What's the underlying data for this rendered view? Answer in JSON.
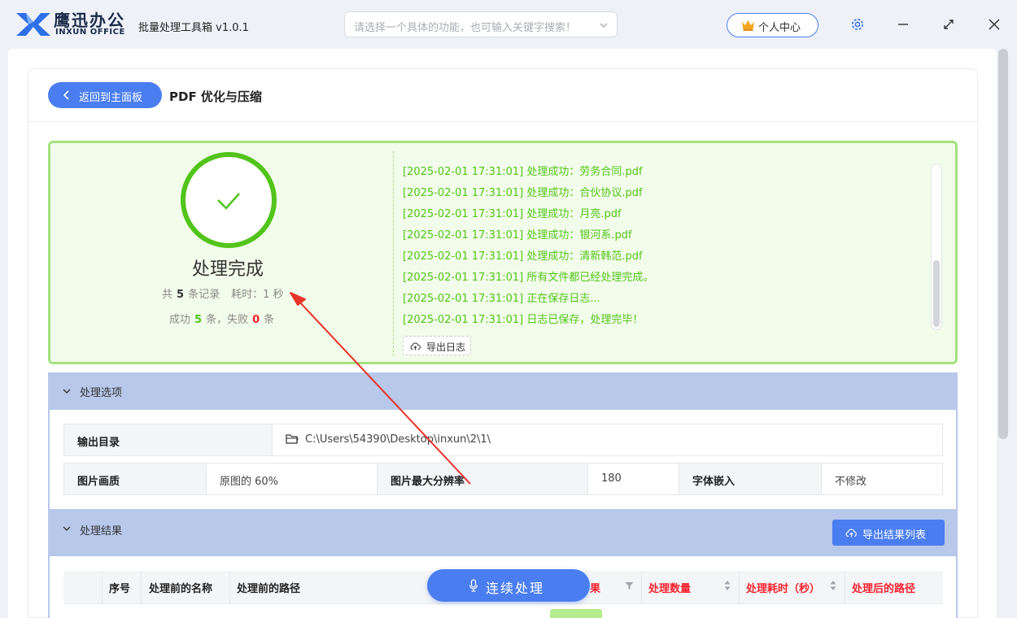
{
  "app": {
    "brand_cn": "鹰迅办公",
    "brand_en": "INXUN OFFICE",
    "title": "批量处理工具箱 v1.0.1",
    "search_placeholder": "请选择一个具体的功能，也可输入关键字搜索！",
    "user_center": "个人中心"
  },
  "page": {
    "back_label": "返回到主面板",
    "title": "PDF 优化与压缩"
  },
  "summary": {
    "title": "处理完成",
    "total_prefix": "共",
    "total_count": "5",
    "total_suffix": "条记录",
    "time_label": "耗时：1 秒",
    "success_prefix": "成功",
    "success_count": "5",
    "success_mid": "条，失败",
    "fail_count": "0",
    "fail_suffix": "条"
  },
  "log": {
    "lines": [
      "[2025-02-01 17:31:01] 处理成功：劳务合同.pdf",
      "[2025-02-01 17:31:01] 处理成功：合伙协议.pdf",
      "[2025-02-01 17:31:01] 处理成功：月亮.pdf",
      "[2025-02-01 17:31:01] 处理成功：银河系.pdf",
      "[2025-02-01 17:31:01] 处理成功：清新韩范.pdf",
      "[2025-02-01 17:31:01] 所有文件都已经处理完成。",
      "[2025-02-01 17:31:01] 正在保存日志...",
      "[2025-02-01 17:31:01] 日志已保存，处理完毕！"
    ],
    "export_label": "导出日志"
  },
  "options": {
    "section_title": "处理选项",
    "output_dir_label": "输出目录",
    "output_dir_value": "C:\\Users\\54390\\Desktop\\inxun\\2\\1\\",
    "quality_label": "图片画质",
    "quality_value": "原图的 60%",
    "max_res_label": "图片最大分辨率",
    "max_res_value": "180",
    "font_embed_label": "字体嵌入",
    "font_embed_value": "不修改"
  },
  "results": {
    "section_title": "处理结果",
    "export_label": "导出结果列表",
    "columns": [
      "序号",
      "处理前的名称",
      "处理前的路径",
      "果",
      "处理数量",
      "处理耗时（秒）",
      "处理后的路径"
    ]
  },
  "continue_label": "连续处理",
  "colors": {
    "accent": "#4a7ef0",
    "success": "#52c41a",
    "fail": "#f5222d",
    "section_header": "#b8c8eb"
  }
}
